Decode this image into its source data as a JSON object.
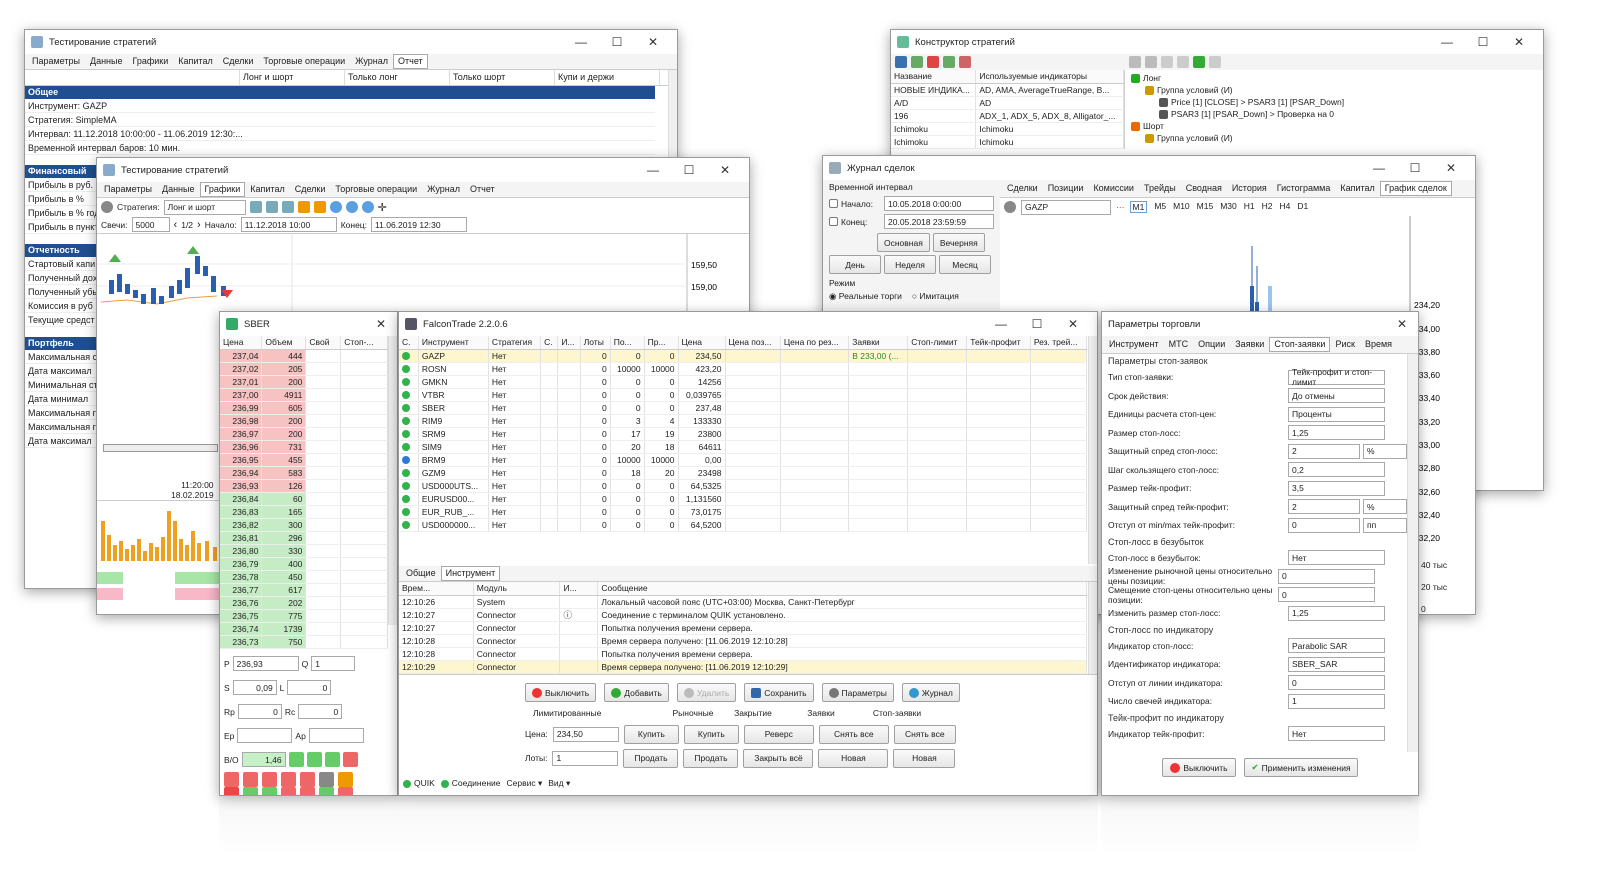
{
  "w1": {
    "title": "Тестирование стратегий",
    "menu": [
      "Параметры",
      "Данные",
      "Графики",
      "Капитал",
      "Сделки",
      "Торговые операции",
      "Журнал",
      "Отчет"
    ],
    "cols": [
      "Лонг и шорт",
      "Только лонг",
      "Только шорт",
      "Купи и держи"
    ],
    "sections": [
      {
        "h": "Общее",
        "rows": [
          "Инструмент: GAZP",
          "Стратегия: SimpleMA",
          "Интервал: 11.12.2018 10:00:00 - 11.06.2019 12:30:...",
          "Временной интервал баров: 10 мин."
        ]
      },
      {
        "h": "Финансовый",
        "rows": [
          "Прибыль в руб.",
          "Прибыль в %",
          "Прибыль в % год",
          "Прибыль в пункт"
        ]
      },
      {
        "h": "Отчетность",
        "rows": [
          "Стартовый капи",
          "Полученный дох",
          "Полученный убы",
          "Комиссия в руб",
          "Текущие средст"
        ]
      },
      {
        "h": "Портфель",
        "rows": [
          "Максимальная с",
          "Дата максимал",
          "Минимальная ст",
          "Дата минимал",
          "Максимальная г",
          "Максимальная г",
          "Дата максимал"
        ]
      }
    ]
  },
  "w2": {
    "title": "Тестирование стратегий",
    "menu": [
      "Параметры",
      "Данные",
      "Графики",
      "Капитал",
      "Сделки",
      "Торговые операции",
      "Журнал",
      "Отчет"
    ],
    "strategy_label": "Стратегия:",
    "strategy": "Лонг и шорт",
    "candles_label": "Свечи:",
    "candles": "5000",
    "page": "1/2",
    "start_label": "Начало:",
    "start": "11.12.2018 10:00",
    "end_label": "Конец:",
    "end": "11.06.2019 12:30",
    "y1": "159,50",
    "y2": "159,00",
    "time": "11:20:00",
    "date": "18.02.2019"
  },
  "w3": {
    "title": "SBER",
    "cols": [
      "Цена",
      "Объем",
      "Свой",
      "Стоп-..."
    ],
    "asks": [
      [
        "237,04",
        "444"
      ],
      [
        "237,02",
        "205"
      ],
      [
        "237,01",
        "200"
      ],
      [
        "237,00",
        "4911"
      ],
      [
        "236,99",
        "605"
      ],
      [
        "236,98",
        "200"
      ],
      [
        "236,97",
        "200"
      ],
      [
        "236,96",
        "731"
      ],
      [
        "236,95",
        "455"
      ],
      [
        "236,94",
        "583"
      ],
      [
        "236,93",
        "126"
      ]
    ],
    "bids": [
      [
        "236,84",
        "60"
      ],
      [
        "236,83",
        "165"
      ],
      [
        "236,82",
        "300"
      ],
      [
        "236,81",
        "296"
      ],
      [
        "236,80",
        "330"
      ],
      [
        "236,79",
        "400"
      ],
      [
        "236,78",
        "450"
      ],
      [
        "236,77",
        "617"
      ],
      [
        "236,76",
        "202"
      ],
      [
        "236,75",
        "775"
      ],
      [
        "236,74",
        "1739"
      ],
      [
        "236,73",
        "750"
      ]
    ],
    "p_label": "P",
    "p": "236,93",
    "q_label": "Q",
    "q": "1",
    "s_label": "S",
    "s": "0,09",
    "l_label": "L",
    "l": "0",
    "rp_label": "Rp",
    "rp": "0",
    "rc_label": "Rc",
    "rc": "0",
    "ep_label": "Ep",
    "ap_label": "Ap",
    "bo_label": "B/O",
    "bo": "1,46"
  },
  "w4": {
    "title": "FalconTrade 2.2.0.6",
    "cols": [
      "С.",
      "Инструмент",
      "Стратегия",
      "С.",
      "И...",
      "Лоты",
      "По...",
      "Пр...",
      "Цена",
      "Цена поз...",
      "Цена по рез...",
      "Заявки",
      "Стоп-лимит",
      "Тейк-профит",
      "Рез. трей..."
    ],
    "rows": [
      [
        "GAZP",
        "Нет",
        "0",
        "0",
        "0",
        "234,50",
        "В 233,00 (..."
      ],
      [
        "ROSN",
        "Нет",
        "0",
        "10000",
        "10000",
        "423,20",
        ""
      ],
      [
        "GMKN",
        "Нет",
        "0",
        "0",
        "0",
        "14256",
        ""
      ],
      [
        "VTBR",
        "Нет",
        "0",
        "0",
        "0",
        "0,039765",
        ""
      ],
      [
        "SBER",
        "Нет",
        "0",
        "0",
        "0",
        "237,48",
        ""
      ],
      [
        "RIM9",
        "Нет",
        "0",
        "3",
        "4",
        "133330",
        ""
      ],
      [
        "SRM9",
        "Нет",
        "0",
        "17",
        "19",
        "23800",
        ""
      ],
      [
        "SIM9",
        "Нет",
        "0",
        "20",
        "18",
        "64611",
        ""
      ],
      [
        "BRM9",
        "Нет",
        "0",
        "10000",
        "10000",
        "0,00",
        ""
      ],
      [
        "GZM9",
        "Нет",
        "0",
        "18",
        "20",
        "23498",
        ""
      ],
      [
        "USD000UTS...",
        "Нет",
        "0",
        "0",
        "0",
        "64,5325",
        ""
      ],
      [
        "EURUSD00...",
        "Нет",
        "0",
        "0",
        "0",
        "1,131560",
        ""
      ],
      [
        "EUR_RUB_...",
        "Нет",
        "0",
        "0",
        "0",
        "73,0175",
        ""
      ],
      [
        "USD000000...",
        "Нет",
        "0",
        "0",
        "0",
        "64,5200",
        ""
      ]
    ],
    "tabs": [
      "Общие",
      "Инструмент"
    ],
    "logcols": [
      "Врем...",
      "Модуль",
      "И...",
      "Сообщение"
    ],
    "log": [
      [
        "12:10:26",
        "System",
        "Локальный часовой пояс (UTC+03:00) Москва, Санкт-Петербург"
      ],
      [
        "12:10:27",
        "Connector",
        "Соединение с терминалом QUIK установлено."
      ],
      [
        "12:10:27",
        "Connector",
        "Попытка получения времени сервера."
      ],
      [
        "12:10:28",
        "Connector",
        "Время сервера получено: [11.06.2019 12:10:28]"
      ],
      [
        "12:10:28",
        "Connector",
        "Попытка получения времени сервера."
      ],
      [
        "12:10:29",
        "Connector",
        "Время сервера получено: [11.06.2019 12:10:29]"
      ]
    ],
    "btns": [
      "Выключить",
      "Добавить",
      "Удалить",
      "Сохранить",
      "Параметры",
      "Журнал"
    ],
    "lim": "Лимитированные",
    "mkt": "Рыночные",
    "cls": "Закрытие",
    "ord": "Заявки",
    "stop": "Стоп-заявки",
    "price_label": "Цена:",
    "price": "234,50",
    "lots_label": "Лоты:",
    "lots": "1",
    "buy": "Купить",
    "sell": "Продать",
    "rev": "Реверс",
    "closeall": "Закрыть всё",
    "cancelall": "Снять все",
    "new": "Новая",
    "status": [
      "QUIK",
      "Соединение",
      "Сервис ▾",
      "Вид ▾"
    ]
  },
  "w5": {
    "title": "Конструктор стратегий",
    "cols": [
      "Название",
      "Используемые индикаторы"
    ],
    "rows": [
      [
        "НОВЫЕ ИНДИКА...",
        "AD, AMA, AverageTrueRange, B..."
      ],
      [
        "A/D",
        "AD"
      ],
      [
        "196",
        "ADX_1, ADX_5, ADX_8, Alligator_..."
      ],
      [
        "Ichimoku",
        "Ichimoku"
      ],
      [
        "Ichimoku",
        "Ichimoku"
      ]
    ],
    "tree": [
      "Лонг",
      "Группа условий (И)",
      "Price [1] [CLOSE] > PSAR3 [1] [PSAR_Down]",
      "PSAR3 [1] [PSAR_Down] > Проверка на 0",
      "Шорт",
      "Группа условий (И)"
    ]
  },
  "w6": {
    "title": "Журнал сделок",
    "interval": "Временной интервал",
    "start_label": "Начало:",
    "start": "10.05.2018  0:00:00",
    "end_label": "Конец:",
    "end": "20.05.2018 23:59:59",
    "b1": "Основная",
    "b2": "Вечерняя",
    "b3": "День",
    "b4": "Неделя",
    "b5": "Месяц",
    "mode": "Режим",
    "m1": "Реальные торги",
    "m2": "Имитация",
    "tabs": [
      "Сделки",
      "Позиции",
      "Комиссии",
      "Трейды",
      "Сводная",
      "История",
      "Гистограмма",
      "Капитал",
      "График сделок"
    ],
    "inst": "GAZP",
    "tfs": [
      "M1",
      "M5",
      "M10",
      "M15",
      "M30",
      "H1",
      "H2",
      "H4",
      "D1"
    ],
    "ylabels": [
      "234,20",
      "234,00",
      "233,80",
      "233,60",
      "233,40",
      "233,20",
      "233,00",
      "232,80",
      "232,60",
      "232,40",
      "232,20"
    ],
    "vol1": "40 тыс",
    "vol2": "20 тыс",
    "vol3": "0",
    "low1": "0",
    "low2": "-50 тыс",
    "low3": "-10 тыс"
  },
  "w7": {
    "title": "Параметры торговли",
    "tabs": [
      "Инструмент",
      "МТС",
      "Опции",
      "Заявки",
      "Стоп-заявки",
      "Риск",
      "Время"
    ],
    "g1": "Параметры стоп-заявок",
    "g2": "Стоп-лосс в безубыток",
    "g3": "Стоп-лосс по индикатору",
    "g4": "Тейк-профит по индикатору",
    "rows": [
      [
        "Тип стоп-заявки:",
        "Тейк-профит и стоп-лимит"
      ],
      [
        "Срок действия:",
        "До отмены"
      ],
      [
        "Единицы расчета стоп-цен:",
        "Проценты"
      ],
      [
        "Размер стоп-лосс:",
        "1,25"
      ],
      [
        "Защитный спред стоп-лосс:",
        "2",
        "%"
      ],
      [
        "Шаг скользящего стоп-лосс:",
        "0,2"
      ],
      [
        "Размер тейк-профит:",
        "3,5"
      ],
      [
        "Защитный спред тейк-профит:",
        "2",
        "%"
      ],
      [
        "Отступ от min/max тейк-профит:",
        "0",
        "пп"
      ]
    ],
    "rows2": [
      [
        "Стоп-лосс в безубыток:",
        "Нет"
      ],
      [
        "Изменение рыночной цены относительно цены позиции:",
        "0"
      ],
      [
        "Смещение стоп-цены относительно цены позиции:",
        "0"
      ],
      [
        "Изменить размер стоп-лосс:",
        "1,25"
      ]
    ],
    "rows3": [
      [
        "Индикатор стоп-лосс:",
        "Parabolic SAR"
      ],
      [
        "Идентификатор индикатора:",
        "SBER_SAR"
      ],
      [
        "Отступ от линии индикатора:",
        "0"
      ],
      [
        "Число свечей индикатора:",
        "1"
      ]
    ],
    "rows4": [
      [
        "Индикатор тейк-профит:",
        "Нет"
      ]
    ],
    "off": "Выключить",
    "apply": "Применить изменения"
  }
}
